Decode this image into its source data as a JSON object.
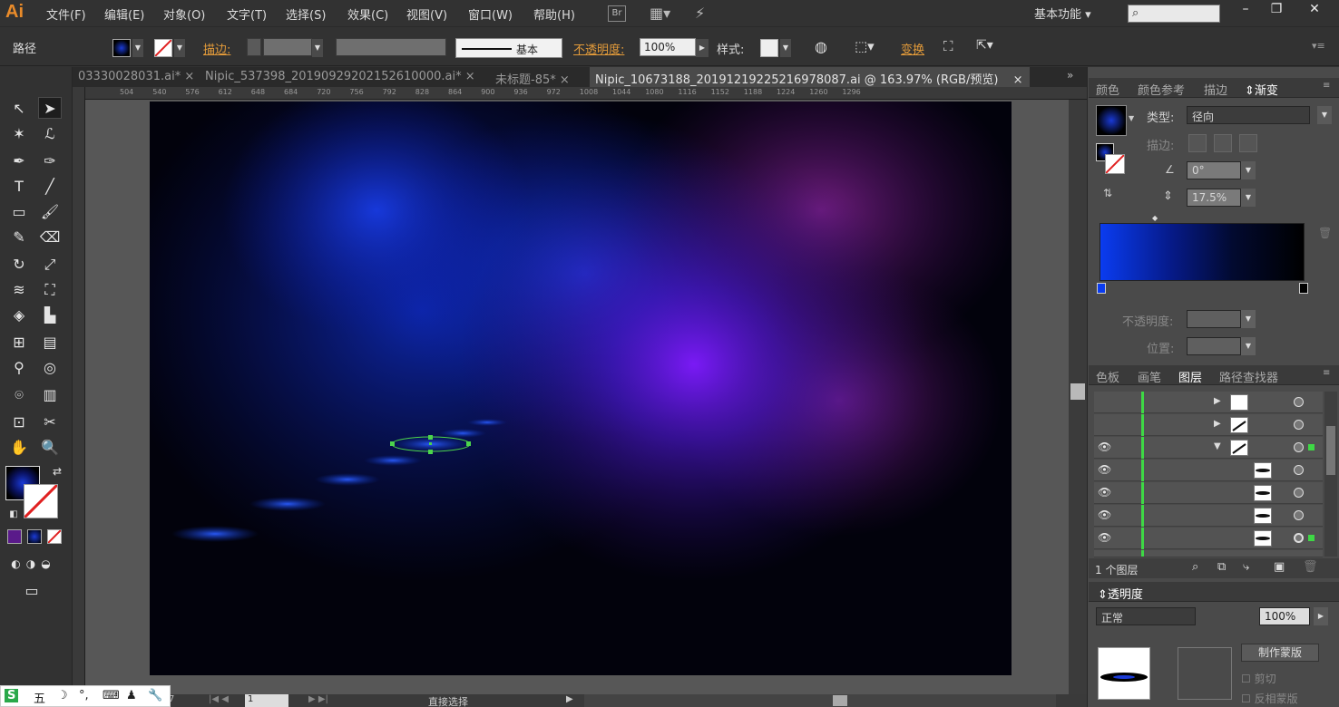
{
  "app": {
    "logo": "Ai",
    "menu": [
      "文件(F)",
      "编辑(E)",
      "对象(O)",
      "文字(T)",
      "选择(S)",
      "效果(C)",
      "视图(V)",
      "窗口(W)",
      "帮助(H)"
    ],
    "bridge_label": "Br",
    "workspace": "基本功能",
    "search_placeholder": "",
    "window_buttons": [
      "–",
      "❐",
      "✕"
    ]
  },
  "controlbar": {
    "selection_type": "路径",
    "stroke_label": "描边:",
    "stroke_style": "基本",
    "opacity_label": "不透明度:",
    "opacity_value": "100%",
    "style_label": "样式:",
    "transform_label": "变换"
  },
  "tabs": [
    {
      "label": "03330028031.ai*",
      "close": "×"
    },
    {
      "label": "Nipic_537398_20190929202152610000.ai*",
      "close": "×"
    },
    {
      "label": "未标题-85*",
      "close": "×"
    },
    {
      "label": "Nipic_10673188_20191219225216978087.ai @ 163.97% (RGB/预览)",
      "close": "×"
    }
  ],
  "ruler_ticks": [
    "504",
    "540",
    "576",
    "612",
    "648",
    "684",
    "720",
    "756",
    "792",
    "828",
    "864",
    "900",
    "936",
    "972",
    "1008",
    "1044",
    "1080",
    "1116",
    "1152",
    "1188",
    "1224",
    "1260",
    "1296"
  ],
  "statusbar": {
    "zoom": "7",
    "page": "1",
    "status_text": "直接选择"
  },
  "panels": {
    "gradient": {
      "tabs": [
        "颜色",
        "颜色参考",
        "描边",
        "渐变"
      ],
      "active_tab": "渐变",
      "type_label": "类型:",
      "type_value": "径向",
      "stroke_label": "描边:",
      "angle_value": "0°",
      "aspect_value": "17.5%",
      "opacity_label": "不透明度:",
      "position_label": "位置:",
      "colors": {
        "start": "#0a3cf0",
        "end": "#000000"
      }
    },
    "layers": {
      "tabs": [
        "色板",
        "画笔",
        "图层",
        "路径查找器"
      ],
      "active_tab": "图层",
      "count_label": "1 个图层",
      "rows": [
        {
          "visible": false,
          "expander": "▶"
        },
        {
          "visible": false,
          "expander": "▶"
        },
        {
          "visible": true,
          "expander": "▼"
        },
        {
          "visible": true,
          "expander": ""
        },
        {
          "visible": true,
          "expander": ""
        },
        {
          "visible": true,
          "expander": ""
        },
        {
          "visible": true,
          "expander": ""
        },
        {
          "visible": true,
          "expander": ""
        }
      ],
      "eye_glyph": "👁"
    },
    "transparency": {
      "title": "透明度",
      "mode": "正常",
      "opacity": "100%",
      "make_mask": "制作蒙版",
      "clip": "剪切",
      "invert_mask": "反相蒙版"
    }
  },
  "ime": {
    "items": [
      "S",
      "五",
      "☽",
      "°,",
      "⌨",
      "♟",
      "🔧"
    ]
  }
}
